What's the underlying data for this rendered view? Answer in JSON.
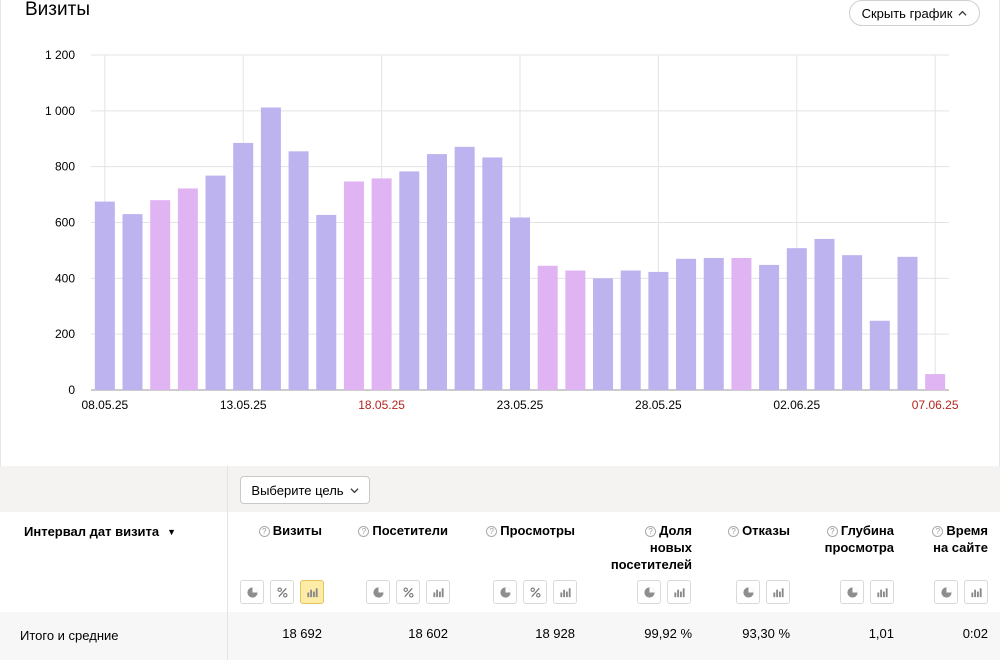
{
  "panel": {
    "title": "Визиты",
    "hide_button_label": "Скрыть график"
  },
  "chart_data": {
    "type": "bar",
    "title": "",
    "ylim": [
      0,
      1200
    ],
    "yticks": [
      "0",
      "200",
      "400",
      "600",
      "800",
      "1 000",
      "1 200"
    ],
    "ytick_values": [
      0,
      200,
      400,
      600,
      800,
      1000,
      1200
    ],
    "xtick_labels": [
      {
        "index": 0,
        "label": "08.05.25",
        "color": "#000000"
      },
      {
        "index": 5,
        "label": "13.05.25",
        "color": "#000000"
      },
      {
        "index": 10,
        "label": "18.05.25",
        "color": "#b3261e"
      },
      {
        "index": 15,
        "label": "23.05.25",
        "color": "#000000"
      },
      {
        "index": 20,
        "label": "28.05.25",
        "color": "#000000"
      },
      {
        "index": 25,
        "label": "02.06.25",
        "color": "#000000"
      },
      {
        "index": 30,
        "label": "07.06.25",
        "color": "#b3261e"
      }
    ],
    "values": [
      675,
      630,
      680,
      722,
      768,
      885,
      1012,
      855,
      627,
      747,
      758,
      783,
      845,
      871,
      833,
      618,
      445,
      428,
      400,
      428,
      423,
      470,
      473,
      473,
      448,
      508,
      541,
      483,
      248,
      477,
      57
    ],
    "weekend": [
      false,
      false,
      true,
      true,
      false,
      false,
      false,
      false,
      false,
      true,
      true,
      false,
      false,
      false,
      false,
      false,
      true,
      true,
      false,
      false,
      false,
      false,
      false,
      true,
      false,
      false,
      false,
      false,
      false,
      false,
      true
    ],
    "colors": {
      "weekday": "#bcb3ef",
      "weekend": "#e0b4f2"
    },
    "grid": true
  },
  "table": {
    "goal_button_label": "Выберите цель",
    "dimension_header": "Интервал дат визита",
    "sort_indicator": "▼",
    "help_glyph": "?",
    "columns": [
      {
        "title_lines": [
          "Визиты"
        ],
        "total": "18 692"
      },
      {
        "title_lines": [
          "Посетители"
        ],
        "total": "18 602"
      },
      {
        "title_lines": [
          "Просмотры"
        ],
        "total": "18 928"
      },
      {
        "title_lines": [
          "Доля",
          "новых",
          "посетителей"
        ],
        "total": "99,92 %"
      },
      {
        "title_lines": [
          "Отказы"
        ],
        "total": "93,30 %"
      },
      {
        "title_lines": [
          "Глубина",
          "просмотра"
        ],
        "total": "1,01"
      },
      {
        "title_lines": [
          "Время",
          "на сайте"
        ],
        "total": "0:02"
      }
    ],
    "total_label": "Итого и средние"
  },
  "icons": {
    "hide_chevron": "chevron-up-icon",
    "goal_chevron": "chevron-down-icon",
    "pie": "pie-chart-icon",
    "percent": "percent-icon",
    "bars": "bar-chart-icon"
  },
  "theme": {
    "active_view": "#fdeba8",
    "weekend_label": "#b3261e"
  }
}
